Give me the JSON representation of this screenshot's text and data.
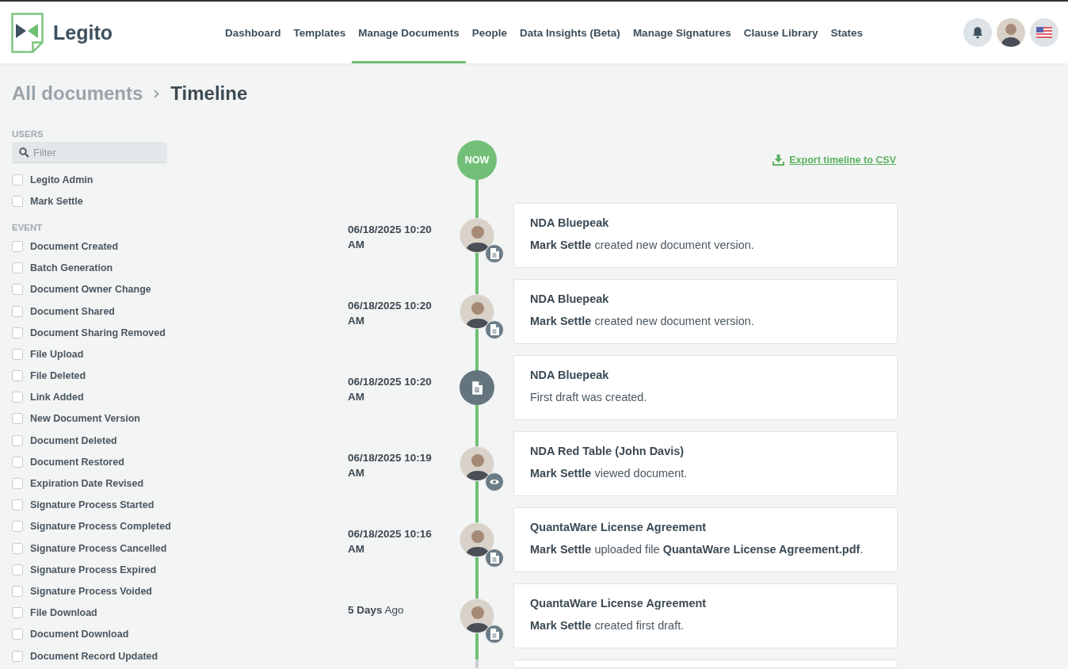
{
  "header": {
    "logo_text": "Legito",
    "nav": [
      {
        "label": "Dashboard",
        "selected": false
      },
      {
        "label": "Templates",
        "selected": false
      },
      {
        "label": "Manage Documents",
        "selected": true
      },
      {
        "label": "People",
        "selected": false
      },
      {
        "label": "Data Insights (Beta)",
        "selected": false
      },
      {
        "label": "Manage Signatures",
        "selected": false
      },
      {
        "label": "Clause Library",
        "selected": false
      },
      {
        "label": "States",
        "selected": false
      }
    ]
  },
  "breadcrumb": {
    "parent": "All documents",
    "current": "Timeline"
  },
  "sidebar": {
    "sections": [
      {
        "title": "USERS",
        "filter_placeholder": "Filter",
        "items": [
          {
            "label": "Legito Admin",
            "checked": false
          },
          {
            "label": "Mark Settle",
            "checked": false
          }
        ]
      },
      {
        "title": "EVENT",
        "items": [
          {
            "label": "Document Created",
            "checked": false
          },
          {
            "label": "Batch Generation",
            "checked": false
          },
          {
            "label": "Document Owner Change",
            "checked": false
          },
          {
            "label": "Document Shared",
            "checked": false
          },
          {
            "label": "Document Sharing Removed",
            "checked": false
          },
          {
            "label": "File Upload",
            "checked": false
          },
          {
            "label": "File Deleted",
            "checked": false
          },
          {
            "label": "Link Added",
            "checked": false
          },
          {
            "label": "New Document Version",
            "checked": false
          },
          {
            "label": "Document Deleted",
            "checked": false
          },
          {
            "label": "Document Restored",
            "checked": false
          },
          {
            "label": "Expiration Date Revised",
            "checked": false
          },
          {
            "label": "Signature Process Started",
            "checked": false
          },
          {
            "label": "Signature Process Completed",
            "checked": false
          },
          {
            "label": "Signature Process Cancelled",
            "checked": false
          },
          {
            "label": "Signature Process Expired",
            "checked": false
          },
          {
            "label": "Signature Process Voided",
            "checked": false
          },
          {
            "label": "File Download",
            "checked": false
          },
          {
            "label": "Document Download",
            "checked": false
          },
          {
            "label": "Document Record Updated",
            "checked": false
          }
        ]
      }
    ]
  },
  "timeline": {
    "now_label": "NOW",
    "export_link": "Export timeline to CSV",
    "events": [
      {
        "kind": "user",
        "time": {
          "kind": "date",
          "text": "06/18/2025 10:20 AM"
        },
        "badge": {
          "kind": "document"
        },
        "title": "NDA Bluepeak",
        "description": "**Mark Settle** created new document version."
      },
      {
        "kind": "user",
        "time": {
          "kind": "date",
          "text": "06/18/2025 10:20 AM"
        },
        "badge": {
          "kind": "document"
        },
        "title": "NDA Bluepeak",
        "description": "**Mark Settle** created new document version."
      },
      {
        "kind": "system",
        "time": {
          "kind": "date",
          "text": "06/18/2025 10:20 AM"
        },
        "title": "NDA Bluepeak",
        "description": "First draft was created."
      },
      {
        "kind": "user",
        "time": {
          "kind": "date",
          "text": "06/18/2025 10:19 AM"
        },
        "badge": {
          "kind": "eye"
        },
        "title": "NDA Red Table (John Davis)",
        "description": "**Mark Settle** viewed document."
      },
      {
        "kind": "user",
        "time": {
          "kind": "date",
          "text": "06/18/2025 10:16 AM"
        },
        "badge": {
          "kind": "document"
        },
        "title": "QuantaWare License Agreement",
        "description": "**Mark Settle** uploaded file **QuantaWare License Agreement.pdf**."
      },
      {
        "kind": "user",
        "time": {
          "kind": "relative",
          "text": "**5 Days** Ago"
        },
        "badge": {
          "kind": "document"
        },
        "title": "QuantaWare License Agreement",
        "description": "**Mark Settle** created first draft."
      }
    ]
  }
}
